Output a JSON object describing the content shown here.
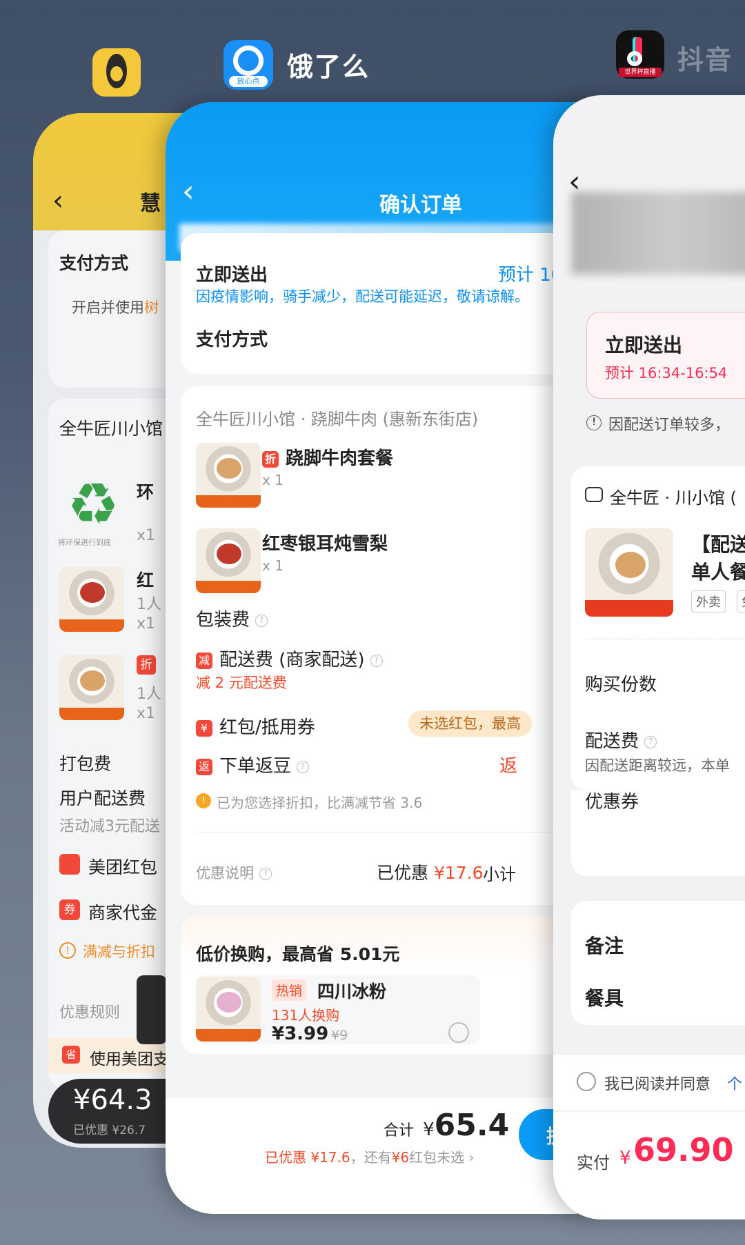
{
  "switcher": {
    "apps": [
      {
        "name": "",
        "icon": "meituan-app-icon",
        "color": "#f4c83a"
      },
      {
        "name": "饿了么",
        "icon": "eleme-app-icon",
        "badge": "放心点",
        "color": "#1a8ff7"
      },
      {
        "name": "抖音",
        "icon": "douyin-app-icon",
        "badge": "世界杯直播",
        "color": "#111111"
      }
    ]
  },
  "left_card": {
    "title": "慧",
    "pay_method": "支付方式",
    "pay_hint": "开启并使用",
    "pay_hint_tail": "树",
    "shop_name": "全牛匠川小馆",
    "items": [
      {
        "label": "环",
        "note": "将环保进行到底",
        "qty": "x1"
      },
      {
        "label": "红",
        "sub": "1人",
        "qty": "x1"
      },
      {
        "label": "",
        "tag": "折",
        "sub": "1人",
        "qty": "x1"
      }
    ],
    "pack_fee": "打包费",
    "delivery_fee": "用户配送费",
    "delivery_note": "活动减3元配送",
    "red_packet": "美团红包",
    "voucher": "商家代金",
    "discount_warning": "满减与折扣",
    "rules": "优惠规则",
    "pay_banner": "使用美团支",
    "total": "¥64.3",
    "saved": "已优惠 ¥26.7"
  },
  "mid_card": {
    "title": "确认订单",
    "deliver_now": "立即送出",
    "eta": "预计 16",
    "notice": "因疫情影响，骑手减少，配送可能延迟，敬请谅解。",
    "pay_method": "支付方式",
    "shop": "全牛匠川小馆 · 跷脚牛肉 (惠新东街店)",
    "items": [
      {
        "tag": "折",
        "name": "跷脚牛肉套餐",
        "qty": "x 1",
        "img_label": "跷脚牛肉套餐"
      },
      {
        "tag": "",
        "name": "红枣银耳炖雪梨",
        "qty": "x 1",
        "img_label": "红枣银耳炖雪梨"
      }
    ],
    "pack_fee": "包装费",
    "delivery_fee": "配送费 (商家配送)",
    "delivery_tag": "减",
    "delivery_discount": "减 2 元配送费",
    "red_packet": "红包/抵用券",
    "red_packet_tag": "¥",
    "red_packet_pill": "未选红包，最高",
    "return_beans": "下单返豆",
    "return_tag": "返",
    "return_value": "返",
    "discount_hint": "已为您选择折扣，比满减节省 3.6",
    "discount_info": "优惠说明",
    "discounted_label": "已优惠",
    "discounted_value": "¥17.6",
    "subtotal_label": "小计",
    "swap_title": "低价换购，最高省 5.01元",
    "swap_item": {
      "hot": "热销",
      "name": "四川冰粉",
      "buyers": "131人换购",
      "price": "¥3.99",
      "old_price": "¥9",
      "img_label": "冰凉香甜·解暑解辣"
    },
    "total_label": "合计",
    "total_currency": "¥",
    "total_value": "65.4",
    "footer_saved": "已优惠 ¥17.6",
    "footer_unused_prefix": "，还有",
    "footer_unused_value": "¥6",
    "footer_unused_suffix": "红包未选",
    "submit": "提"
  },
  "right_card": {
    "deliver_now": "立即送出",
    "eta": "预计 16:34-16:54",
    "notice": "因配送订单较多，",
    "shop": "全牛匠 · 川小馆",
    "shop_tail": "(",
    "product_title": "【配送",
    "product_sub": "单人餐",
    "product_img_label": "宠爱牛牛单人餐",
    "tags": [
      "外卖",
      "免"
    ],
    "qty_label": "购买份数",
    "delivery_fee": "配送费",
    "delivery_note": "因配送距离较远，本单",
    "coupon": "优惠券",
    "remark": "备注",
    "tableware": "餐具",
    "agree": "我已阅读并同意",
    "agree_tail": "个",
    "pay_label": "实付",
    "pay_currency": "¥",
    "pay_value": "69.90"
  },
  "colors": {
    "eleme_blue": "#0a9bf5",
    "price_red": "#f24a2a",
    "douyin_red": "#fe2c55",
    "meituan_yellow": "#f4c83a"
  }
}
